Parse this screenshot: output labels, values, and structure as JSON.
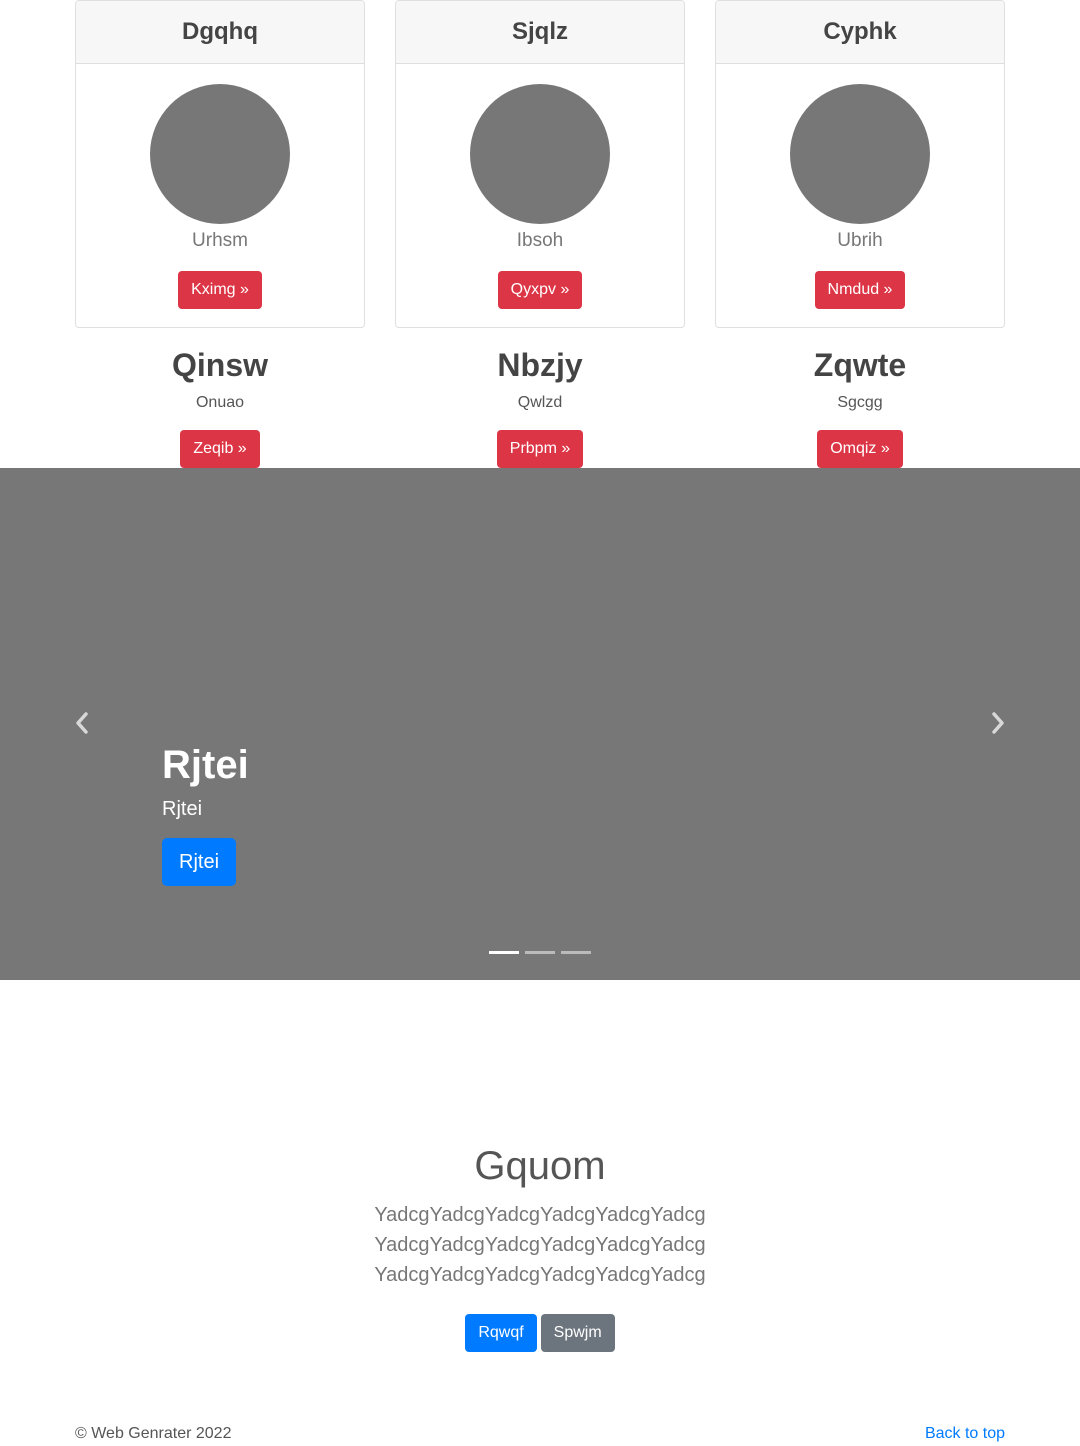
{
  "cards": [
    {
      "title": "Dgqhq",
      "subtitle": "Urhsm",
      "button": "Kximg »"
    },
    {
      "title": "Sjqlz",
      "subtitle": "Ibsoh",
      "button": "Qyxpv »"
    },
    {
      "title": "Cyphk",
      "subtitle": "Ubrih",
      "button": "Nmdud »"
    }
  ],
  "features": [
    {
      "title": "Qinsw",
      "text": "Onuao",
      "button": "Zeqib »"
    },
    {
      "title": "Nbzjy",
      "text": "Qwlzd",
      "button": "Prbpm »"
    },
    {
      "title": "Zqwte",
      "text": "Sgcgg",
      "button": "Omqiz »"
    }
  ],
  "carousel": {
    "caption_title": "Rjtei",
    "caption_text": "Rjtei",
    "caption_button": "Rjtei",
    "prev_icon": "chevron-left-icon",
    "next_icon": "chevron-right-icon",
    "slide_count": 3,
    "active_slide": 1,
    "background": "#777777"
  },
  "jumbotron": {
    "title": "Gquom",
    "lead": "YadcgYadcgYadcgYadcgYadcgYadcg YadcgYadcgYadcgYadcgYadcgYadcg YadcgYadcgYadcgYadcgYadcgYadcg",
    "primary_button": "Rqwqf",
    "secondary_button": "Spwjm"
  },
  "footer": {
    "copyright": "© Web Genrater 2022",
    "back_to_top": "Back to top"
  },
  "colors": {
    "danger": "#dc3545",
    "primary": "#007bff",
    "secondary": "#6c757d",
    "placeholder": "#777777"
  }
}
